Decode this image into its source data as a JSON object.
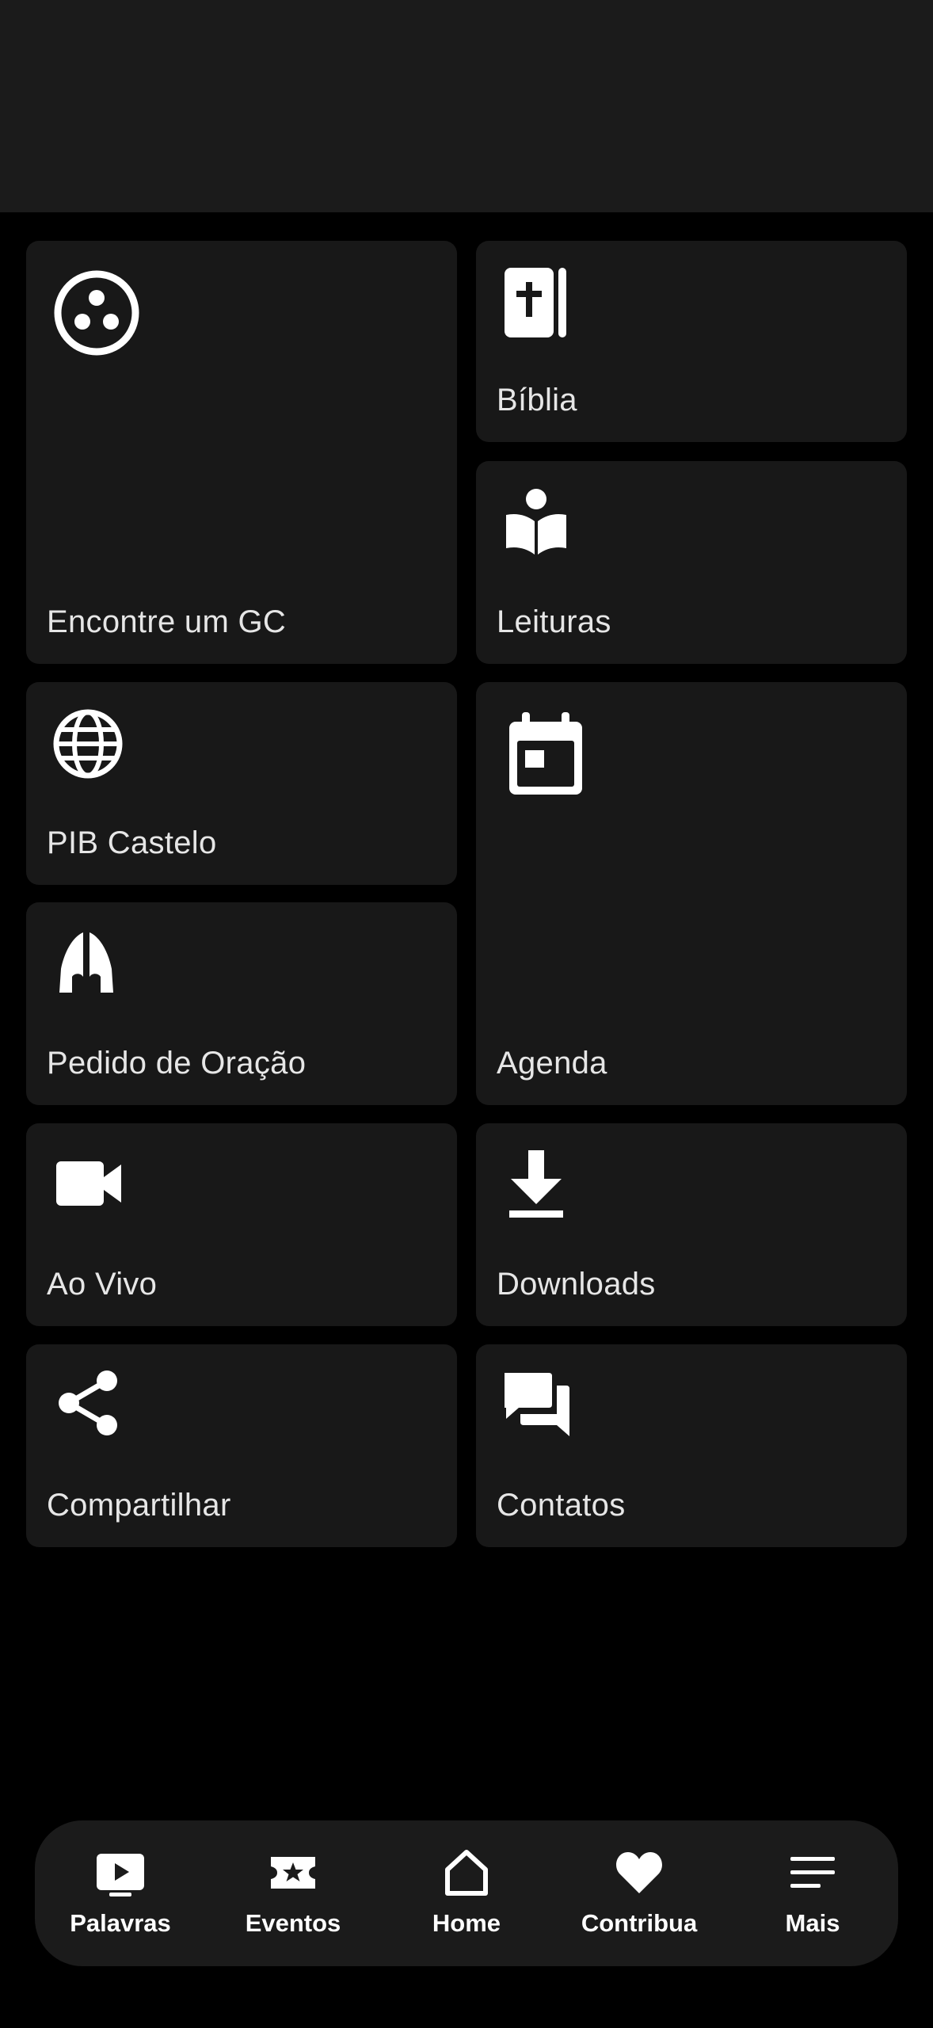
{
  "tiles": [
    {
      "label": "Encontre um GC",
      "icon": "group-circle-icon"
    },
    {
      "label": "Bíblia",
      "icon": "bible-icon"
    },
    {
      "label": "Leituras",
      "icon": "reading-icon"
    },
    {
      "label": "PIB Castelo",
      "icon": "globe-icon"
    },
    {
      "label": "Agenda",
      "icon": "calendar-icon"
    },
    {
      "label": "Pedido de Oração",
      "icon": "praying-hands-icon"
    },
    {
      "label": "Ao Vivo",
      "icon": "video-camera-icon"
    },
    {
      "label": "Downloads",
      "icon": "download-icon"
    },
    {
      "label": "Compartilhar",
      "icon": "share-icon"
    },
    {
      "label": "Contatos",
      "icon": "chat-icon"
    }
  ],
  "nav": [
    {
      "label": "Palavras",
      "icon": "play-video-icon"
    },
    {
      "label": "Eventos",
      "icon": "ticket-star-icon"
    },
    {
      "label": "Home",
      "icon": "home-icon"
    },
    {
      "label": "Contribua",
      "icon": "heart-icon"
    },
    {
      "label": "Mais",
      "icon": "menu-icon"
    }
  ],
  "colors": {
    "background": "#000000",
    "tile": "#181818",
    "header": "#1b1b1b",
    "text": "#e6e6e6",
    "icon": "#ffffff"
  }
}
